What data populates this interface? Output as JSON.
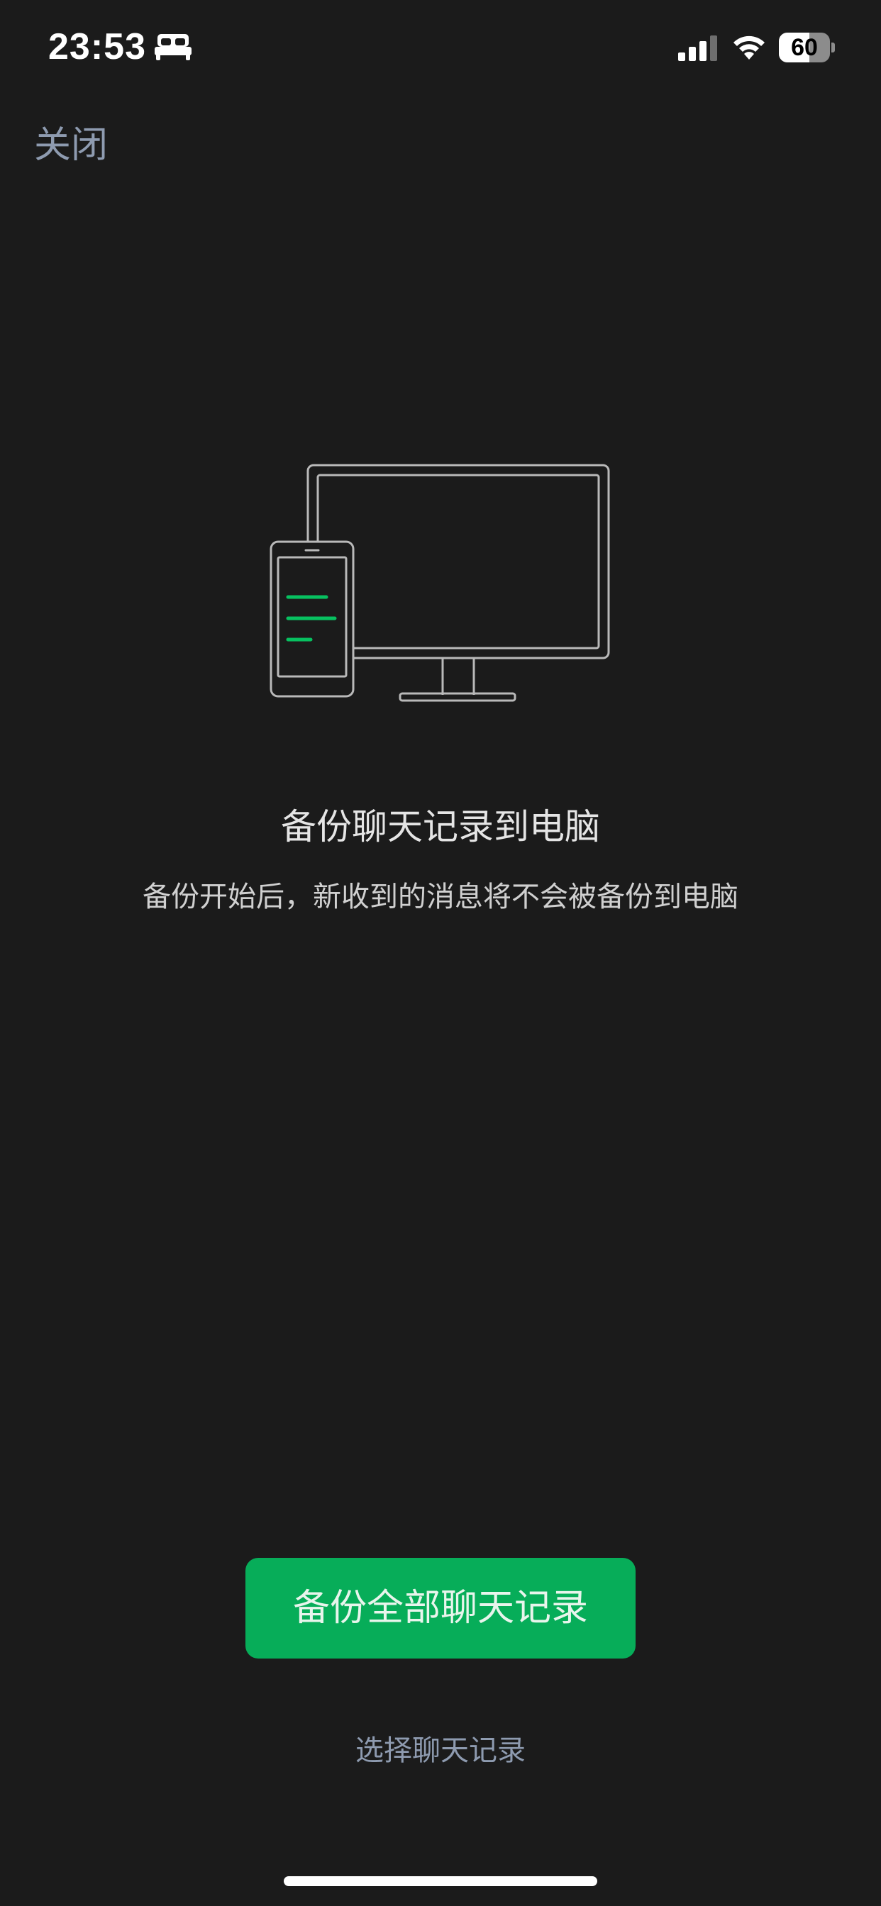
{
  "status_bar": {
    "time": "23:53",
    "focus_icon": "bed-icon",
    "battery_level": 60,
    "battery_text": "60"
  },
  "nav": {
    "close_label": "关闭"
  },
  "main": {
    "illustration_icon": "phone-to-computer-icon",
    "title": "备份聊天记录到电脑",
    "subtitle": "备份开始后，新收到的消息将不会被备份到电脑"
  },
  "actions": {
    "primary_label": "备份全部聊天记录",
    "secondary_label": "选择聊天记录"
  },
  "colors": {
    "background": "#1b1b1b",
    "accent": "#07ad59",
    "link": "#8e9bb0"
  }
}
